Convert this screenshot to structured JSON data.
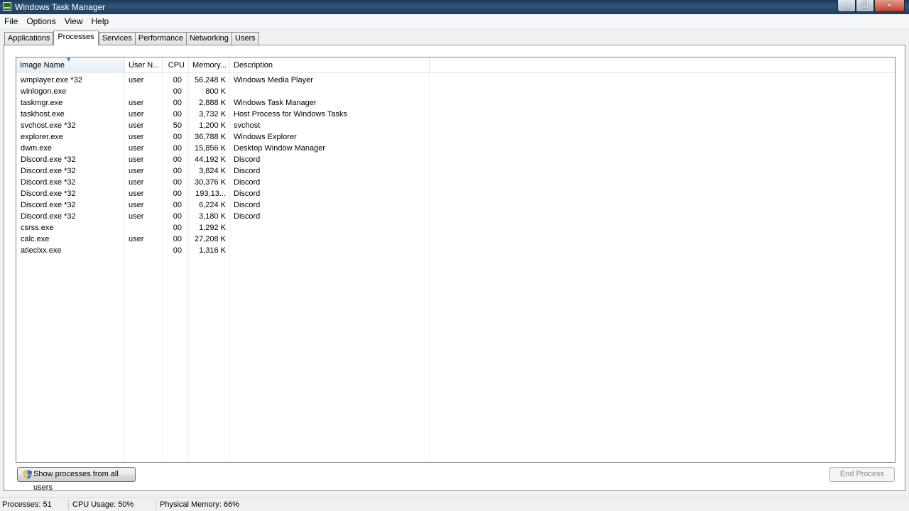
{
  "window": {
    "title": "Windows Task Manager"
  },
  "menu": [
    "File",
    "Options",
    "View",
    "Help"
  ],
  "tabs": [
    "Applications",
    "Processes",
    "Services",
    "Performance",
    "Networking",
    "Users"
  ],
  "active_tab": "Processes",
  "columns": {
    "image_name": "Image Name",
    "user_name": "User N...",
    "cpu": "CPU",
    "memory": "Memory...",
    "description": "Description"
  },
  "processes": [
    {
      "name": "wmplayer.exe *32",
      "user": "user",
      "cpu": "00",
      "mem": "56,248 K",
      "desc": "Windows Media Player"
    },
    {
      "name": "winlogon.exe",
      "user": "",
      "cpu": "00",
      "mem": "800 K",
      "desc": ""
    },
    {
      "name": "taskmgr.exe",
      "user": "user",
      "cpu": "00",
      "mem": "2,888 K",
      "desc": "Windows Task Manager"
    },
    {
      "name": "taskhost.exe",
      "user": "user",
      "cpu": "00",
      "mem": "3,732 K",
      "desc": "Host Process for Windows Tasks"
    },
    {
      "name": "svchost.exe *32",
      "user": "user",
      "cpu": "50",
      "mem": "1,200 K",
      "desc": "svchost"
    },
    {
      "name": "explorer.exe",
      "user": "user",
      "cpu": "00",
      "mem": "36,788 K",
      "desc": "Windows Explorer"
    },
    {
      "name": "dwm.exe",
      "user": "user",
      "cpu": "00",
      "mem": "15,856 K",
      "desc": "Desktop Window Manager"
    },
    {
      "name": "Discord.exe *32",
      "user": "user",
      "cpu": "00",
      "mem": "44,192 K",
      "desc": "Discord"
    },
    {
      "name": "Discord.exe *32",
      "user": "user",
      "cpu": "00",
      "mem": "3,824 K",
      "desc": "Discord"
    },
    {
      "name": "Discord.exe *32",
      "user": "user",
      "cpu": "00",
      "mem": "30,376 K",
      "desc": "Discord"
    },
    {
      "name": "Discord.exe *32",
      "user": "user",
      "cpu": "00",
      "mem": "193,13...",
      "desc": "Discord"
    },
    {
      "name": "Discord.exe *32",
      "user": "user",
      "cpu": "00",
      "mem": "6,224 K",
      "desc": "Discord"
    },
    {
      "name": "Discord.exe *32",
      "user": "user",
      "cpu": "00",
      "mem": "3,180 K",
      "desc": "Discord"
    },
    {
      "name": "csrss.exe",
      "user": "",
      "cpu": "00",
      "mem": "1,292 K",
      "desc": ""
    },
    {
      "name": "calc.exe",
      "user": "user",
      "cpu": "00",
      "mem": "27,208 K",
      "desc": ""
    },
    {
      "name": "atieclxx.exe",
      "user": "",
      "cpu": "00",
      "mem": "1,316 K",
      "desc": ""
    }
  ],
  "buttons": {
    "show_all": "Show processes from all users",
    "end_process": "End Process"
  },
  "status": {
    "processes": "Processes: 51",
    "cpu": "CPU Usage: 50%",
    "memory": "Physical Memory: 66%"
  },
  "icons": {
    "app": "task-manager-icon",
    "shield": "uac-shield-icon",
    "sort": "sort-ascending-icon"
  }
}
